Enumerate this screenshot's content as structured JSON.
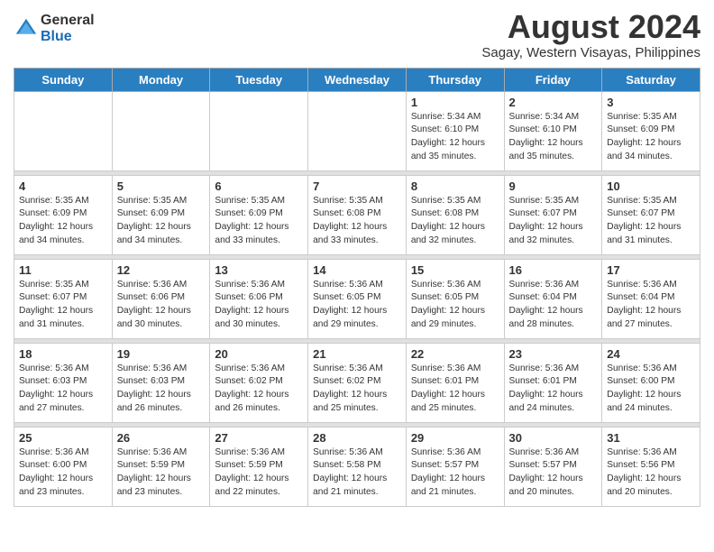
{
  "header": {
    "logo_general": "General",
    "logo_blue": "Blue",
    "month_year": "August 2024",
    "location": "Sagay, Western Visayas, Philippines"
  },
  "days_of_week": [
    "Sunday",
    "Monday",
    "Tuesday",
    "Wednesday",
    "Thursday",
    "Friday",
    "Saturday"
  ],
  "weeks": [
    {
      "days": [
        {
          "number": "",
          "info": ""
        },
        {
          "number": "",
          "info": ""
        },
        {
          "number": "",
          "info": ""
        },
        {
          "number": "",
          "info": ""
        },
        {
          "number": "1",
          "info": "Sunrise: 5:34 AM\nSunset: 6:10 PM\nDaylight: 12 hours\nand 35 minutes."
        },
        {
          "number": "2",
          "info": "Sunrise: 5:34 AM\nSunset: 6:10 PM\nDaylight: 12 hours\nand 35 minutes."
        },
        {
          "number": "3",
          "info": "Sunrise: 5:35 AM\nSunset: 6:09 PM\nDaylight: 12 hours\nand 34 minutes."
        }
      ]
    },
    {
      "days": [
        {
          "number": "4",
          "info": "Sunrise: 5:35 AM\nSunset: 6:09 PM\nDaylight: 12 hours\nand 34 minutes."
        },
        {
          "number": "5",
          "info": "Sunrise: 5:35 AM\nSunset: 6:09 PM\nDaylight: 12 hours\nand 34 minutes."
        },
        {
          "number": "6",
          "info": "Sunrise: 5:35 AM\nSunset: 6:09 PM\nDaylight: 12 hours\nand 33 minutes."
        },
        {
          "number": "7",
          "info": "Sunrise: 5:35 AM\nSunset: 6:08 PM\nDaylight: 12 hours\nand 33 minutes."
        },
        {
          "number": "8",
          "info": "Sunrise: 5:35 AM\nSunset: 6:08 PM\nDaylight: 12 hours\nand 32 minutes."
        },
        {
          "number": "9",
          "info": "Sunrise: 5:35 AM\nSunset: 6:07 PM\nDaylight: 12 hours\nand 32 minutes."
        },
        {
          "number": "10",
          "info": "Sunrise: 5:35 AM\nSunset: 6:07 PM\nDaylight: 12 hours\nand 31 minutes."
        }
      ]
    },
    {
      "days": [
        {
          "number": "11",
          "info": "Sunrise: 5:35 AM\nSunset: 6:07 PM\nDaylight: 12 hours\nand 31 minutes."
        },
        {
          "number": "12",
          "info": "Sunrise: 5:36 AM\nSunset: 6:06 PM\nDaylight: 12 hours\nand 30 minutes."
        },
        {
          "number": "13",
          "info": "Sunrise: 5:36 AM\nSunset: 6:06 PM\nDaylight: 12 hours\nand 30 minutes."
        },
        {
          "number": "14",
          "info": "Sunrise: 5:36 AM\nSunset: 6:05 PM\nDaylight: 12 hours\nand 29 minutes."
        },
        {
          "number": "15",
          "info": "Sunrise: 5:36 AM\nSunset: 6:05 PM\nDaylight: 12 hours\nand 29 minutes."
        },
        {
          "number": "16",
          "info": "Sunrise: 5:36 AM\nSunset: 6:04 PM\nDaylight: 12 hours\nand 28 minutes."
        },
        {
          "number": "17",
          "info": "Sunrise: 5:36 AM\nSunset: 6:04 PM\nDaylight: 12 hours\nand 27 minutes."
        }
      ]
    },
    {
      "days": [
        {
          "number": "18",
          "info": "Sunrise: 5:36 AM\nSunset: 6:03 PM\nDaylight: 12 hours\nand 27 minutes."
        },
        {
          "number": "19",
          "info": "Sunrise: 5:36 AM\nSunset: 6:03 PM\nDaylight: 12 hours\nand 26 minutes."
        },
        {
          "number": "20",
          "info": "Sunrise: 5:36 AM\nSunset: 6:02 PM\nDaylight: 12 hours\nand 26 minutes."
        },
        {
          "number": "21",
          "info": "Sunrise: 5:36 AM\nSunset: 6:02 PM\nDaylight: 12 hours\nand 25 minutes."
        },
        {
          "number": "22",
          "info": "Sunrise: 5:36 AM\nSunset: 6:01 PM\nDaylight: 12 hours\nand 25 minutes."
        },
        {
          "number": "23",
          "info": "Sunrise: 5:36 AM\nSunset: 6:01 PM\nDaylight: 12 hours\nand 24 minutes."
        },
        {
          "number": "24",
          "info": "Sunrise: 5:36 AM\nSunset: 6:00 PM\nDaylight: 12 hours\nand 24 minutes."
        }
      ]
    },
    {
      "days": [
        {
          "number": "25",
          "info": "Sunrise: 5:36 AM\nSunset: 6:00 PM\nDaylight: 12 hours\nand 23 minutes."
        },
        {
          "number": "26",
          "info": "Sunrise: 5:36 AM\nSunset: 5:59 PM\nDaylight: 12 hours\nand 23 minutes."
        },
        {
          "number": "27",
          "info": "Sunrise: 5:36 AM\nSunset: 5:59 PM\nDaylight: 12 hours\nand 22 minutes."
        },
        {
          "number": "28",
          "info": "Sunrise: 5:36 AM\nSunset: 5:58 PM\nDaylight: 12 hours\nand 21 minutes."
        },
        {
          "number": "29",
          "info": "Sunrise: 5:36 AM\nSunset: 5:57 PM\nDaylight: 12 hours\nand 21 minutes."
        },
        {
          "number": "30",
          "info": "Sunrise: 5:36 AM\nSunset: 5:57 PM\nDaylight: 12 hours\nand 20 minutes."
        },
        {
          "number": "31",
          "info": "Sunrise: 5:36 AM\nSunset: 5:56 PM\nDaylight: 12 hours\nand 20 minutes."
        }
      ]
    }
  ]
}
